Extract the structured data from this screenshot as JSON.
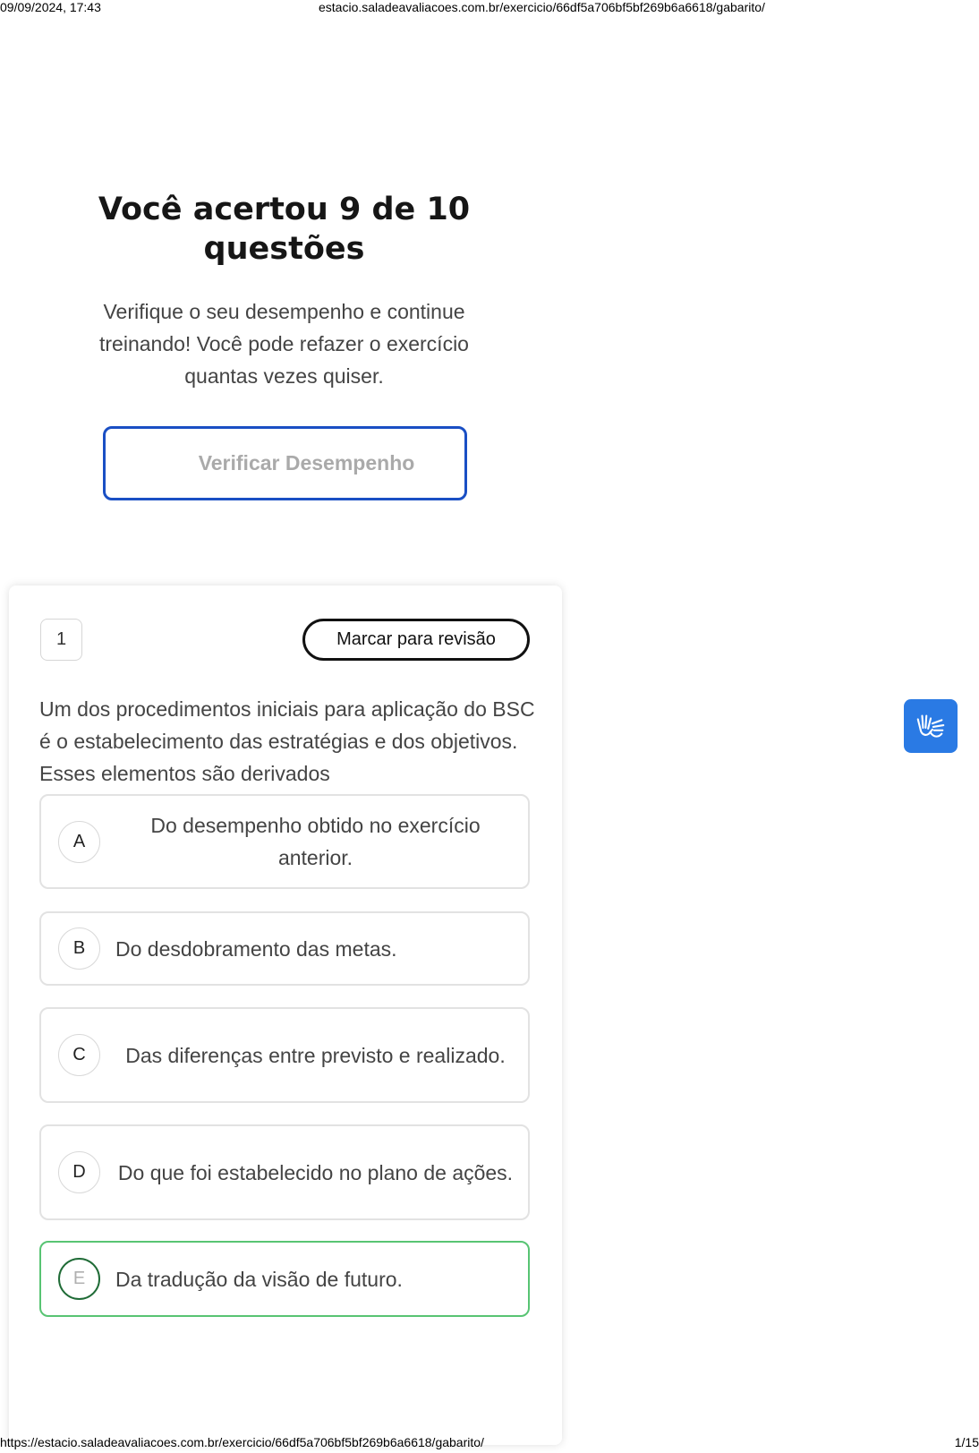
{
  "print_header": {
    "datetime": "09/09/2024, 17:43",
    "url": "estacio.saladeavaliacoes.com.br/exercicio/66df5a706bf5bf269b6a6618/gabarito/"
  },
  "result": {
    "title": "Você acertou 9 de 10 questões",
    "subtitle": "Verifique o seu desempenho e continue treinando! Você pode refazer o exercício quantas vezes quiser.",
    "verify_label": "Verificar Desempenho"
  },
  "question": {
    "number": "1",
    "review_label": "Marcar para revisão",
    "text": "Um dos procedimentos iniciais para aplicação do BSC é o estabelecimento das estratégias e dos objetivos. Esses elementos são derivados",
    "options": [
      {
        "letter": "A",
        "text": "Do desempenho obtido no exercício anterior."
      },
      {
        "letter": "B",
        "text": "Do desdobramento das metas."
      },
      {
        "letter": "C",
        "text": "Das diferenças entre previsto e realizado."
      },
      {
        "letter": "D",
        "text": "Do que foi estabelecido no plano de ações."
      },
      {
        "letter": "E",
        "text": "Da tradução da visão de futuro."
      }
    ]
  },
  "accessibility": {
    "icon": "sign-language-icon",
    "color": "#2a7ae4"
  },
  "colors": {
    "accent": "#1a4fc4",
    "correct": "#58c473"
  },
  "print_footer": {
    "url": "https://estacio.saladeavaliacoes.com.br/exercicio/66df5a706bf5bf269b6a6618/gabarito/",
    "page": "1/15"
  }
}
